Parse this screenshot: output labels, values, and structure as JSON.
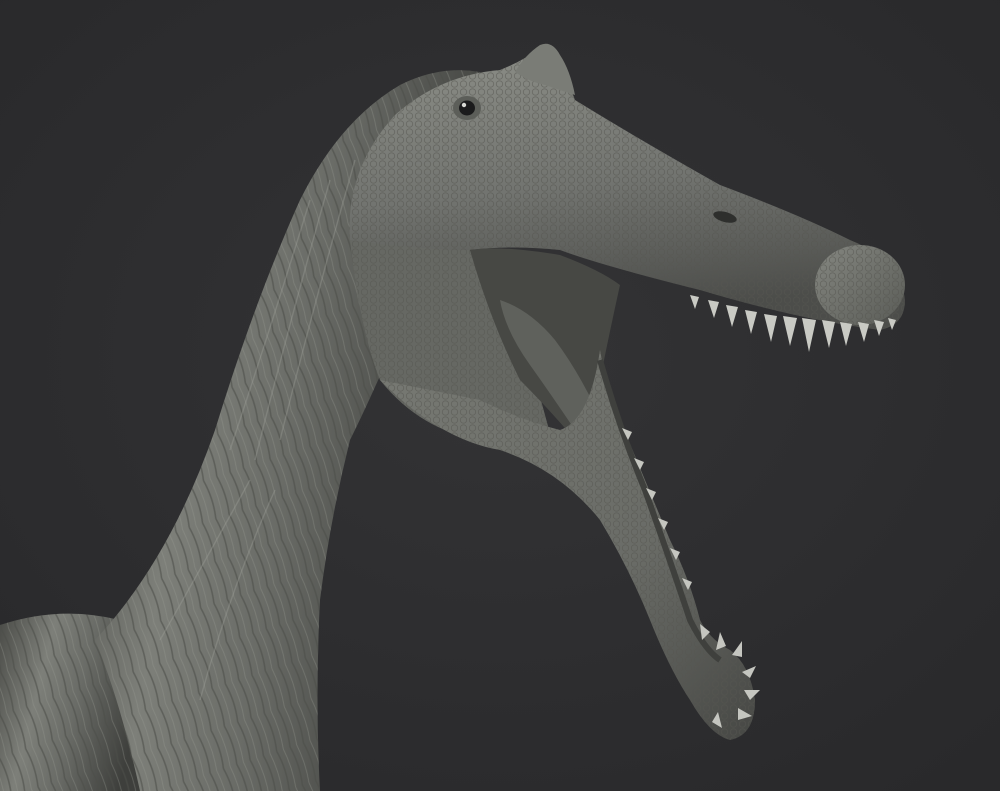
{
  "scene": {
    "subject_icon": "dinosaur-head-sculpt-icon",
    "colors": {
      "background": "#2d2d2f",
      "skin_base": "#6e706b",
      "skin_light": "#a3a59e",
      "skin_dark": "#3b3c39",
      "teeth": "#c9cac4",
      "mouth_interior": "#4a4b47"
    }
  }
}
